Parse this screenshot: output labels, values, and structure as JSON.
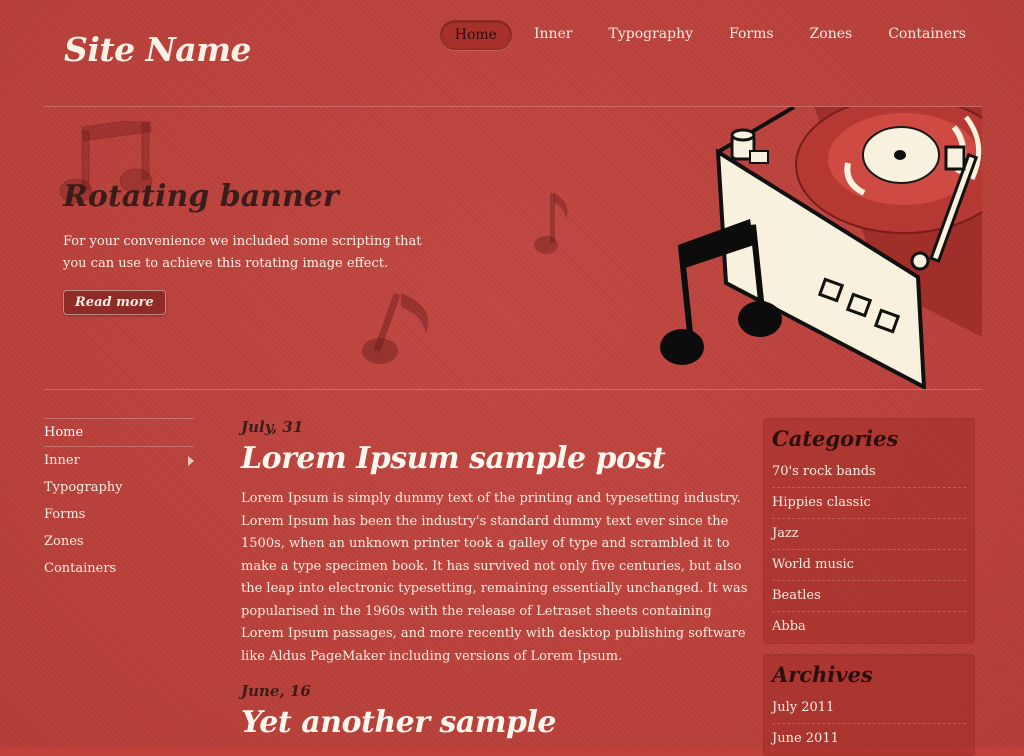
{
  "site": {
    "name": "Site Name"
  },
  "topnav": [
    {
      "label": "Home",
      "active": true
    },
    {
      "label": "Inner"
    },
    {
      "label": "Typography"
    },
    {
      "label": "Forms"
    },
    {
      "label": "Zones"
    },
    {
      "label": "Containers"
    }
  ],
  "banner": {
    "title": "Rotating banner",
    "text": "For your convenience we included some scripting that you can use to achieve this rotating image effect.",
    "button": "Read more"
  },
  "leftnav": [
    {
      "label": "Home",
      "has_children": false
    },
    {
      "label": "Inner",
      "has_children": true
    },
    {
      "label": "Typography",
      "has_children": false
    },
    {
      "label": "Forms",
      "has_children": false
    },
    {
      "label": "Zones",
      "has_children": false
    },
    {
      "label": "Containers",
      "has_children": false
    }
  ],
  "posts": [
    {
      "date": "July, 31",
      "title": "Lorem Ipsum sample post",
      "body": "Lorem Ipsum is simply dummy text of the printing and typesetting industry. Lorem Ipsum has been the industry's standard dummy text ever since the 1500s, when an unknown printer took a galley of type and scrambled it to make a type specimen book. It has survived not only five centuries, but also the leap into electronic typesetting, remaining essentially unchanged. It was popularised in the 1960s with the release of Letraset sheets containing Lorem Ipsum passages, and more recently with desktop publishing software like Aldus PageMaker including versions of Lorem Ipsum."
    },
    {
      "date": "June, 16",
      "title": "Yet another sample",
      "body": ""
    }
  ],
  "sidebar": {
    "categories": {
      "title": "Categories",
      "items": [
        "70's rock bands",
        "Hippies classic",
        "Jazz",
        "World music",
        "Beatles",
        "Abba"
      ]
    },
    "archives": {
      "title": "Archives",
      "items": [
        "July 2011",
        "June 2011"
      ]
    }
  },
  "colors": {
    "background": "#c0403a",
    "dark_text": "#2a0f0d",
    "button": "#8f2b27"
  }
}
